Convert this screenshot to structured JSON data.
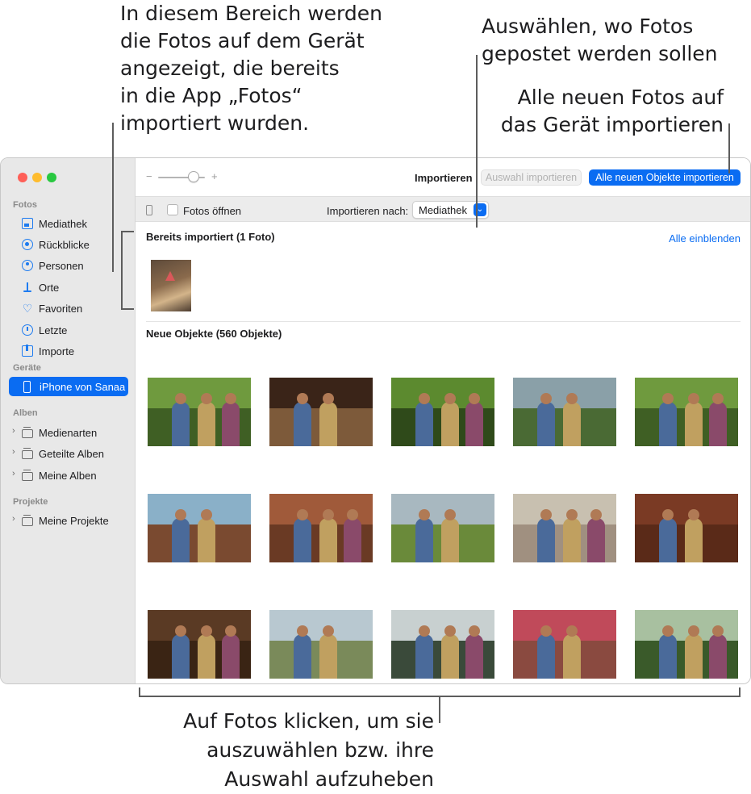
{
  "callouts": {
    "imported_area": "In diesem Bereich werden\ndie Fotos auf dem Gerät\nangezeigt, die bereits\nin die App „Fotos“\nimportiert wurden.",
    "choose_destination": "Auswählen, wo Fotos\ngepostet werden sollen",
    "import_all": "Alle neuen Fotos auf\ndas Gerät importieren",
    "click_photos": "Auf Fotos klicken, um sie\nauszuwählen bzw. ihre\nAuswahl aufzuheben"
  },
  "sidebar": {
    "section_photos": "Fotos",
    "items": [
      {
        "label": "Mediathek",
        "icon": "library-icon"
      },
      {
        "label": "Rückblicke",
        "icon": "memories-icon"
      },
      {
        "label": "Personen",
        "icon": "people-icon"
      },
      {
        "label": "Orte",
        "icon": "places-icon"
      },
      {
        "label": "Favoriten",
        "icon": "heart-icon"
      },
      {
        "label": "Letzte",
        "icon": "clock-icon"
      },
      {
        "label": "Importe",
        "icon": "import-icon"
      }
    ],
    "section_devices": "Geräte",
    "device": "iPhone von Sanaa",
    "section_albums": "Alben",
    "albums": [
      "Medienarten",
      "Geteilte Alben",
      "Meine Alben"
    ],
    "section_projects": "Projekte",
    "projects": [
      "Meine Projekte"
    ]
  },
  "toolbar": {
    "zoom_minus": "−",
    "zoom_plus": "+",
    "zoom_level": 0.75,
    "title": "Importieren",
    "import_selection": "Auswahl importieren",
    "import_all": "Alle neuen Objekte importieren"
  },
  "options": {
    "open_photos": "Fotos öffnen",
    "open_photos_checked": false,
    "import_to_label": "Importieren nach:",
    "import_to_value": "Mediathek"
  },
  "content": {
    "already_imported": "Bereits importiert (1 Foto)",
    "show_all": "Alle einblenden",
    "new_items": "Neue Objekte (560 Objekte)"
  },
  "colors": {
    "accent": "#0a6cf2",
    "sidebar_bg": "#e8e8e8",
    "traffic_red": "#fe5f57",
    "traffic_yellow": "#febc2e",
    "traffic_green": "#28c840"
  }
}
